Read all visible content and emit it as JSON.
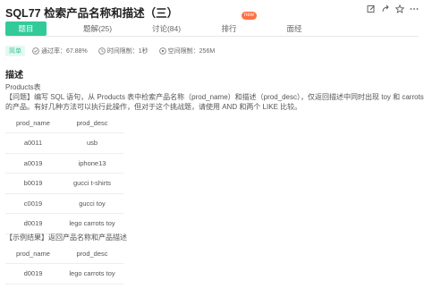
{
  "header": {
    "title": "SQL77  检索产品名称和描述（三）",
    "icons": [
      "edit-icon",
      "share-icon",
      "star-icon",
      "more-icon"
    ]
  },
  "tabs": [
    {
      "label": "题目",
      "active": true
    },
    {
      "label": "题解(25)",
      "active": false
    },
    {
      "label": "讨论(84)",
      "active": false
    },
    {
      "label": "排行",
      "active": false
    },
    {
      "label": "面经",
      "active": false
    }
  ],
  "new_badge": "new",
  "meta": {
    "difficulty": "简单",
    "pass_rate": "通过率：67.88%",
    "time_limit": "时间限制：1秒",
    "space_limit": "空间限制：256M"
  },
  "description": {
    "heading": "描述",
    "table_name": "Products表",
    "problem_line1": "【问题】编写 SQL 语句，从 Products 表中检索产品名称（prod_name）和描述（prod_desc），仅返回描述中同时出现 toy 和 carrots",
    "problem_line2": "的产品。有好几种方法可以执行此操作，但对于这个挑战题，请使用 AND 和两个 LIKE 比较。",
    "table": {
      "columns": [
        "prod_name",
        "prod_desc"
      ],
      "rows": [
        [
          "a0011",
          "usb"
        ],
        [
          "a0019",
          "iphone13"
        ],
        [
          "b0019",
          "gucci t-shirts"
        ],
        [
          "c0019",
          "gucci toy"
        ],
        [
          "d0019",
          "lego carrots toy"
        ]
      ]
    },
    "example_label": "【示例结果】返回产品名称和产品描述",
    "result_table": {
      "columns": [
        "prod_name",
        "prod_desc"
      ],
      "rows": [
        [
          "d0019",
          "lego carrots toy"
        ]
      ]
    }
  }
}
